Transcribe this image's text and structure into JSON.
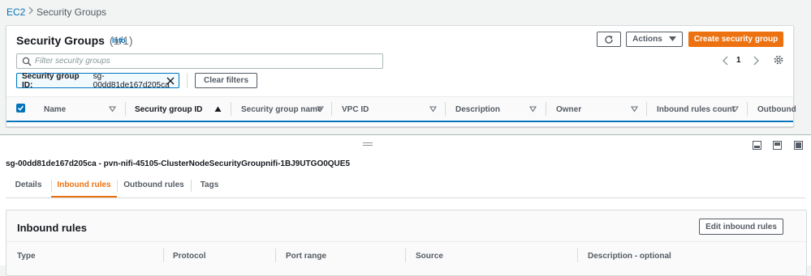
{
  "breadcrumb": {
    "root": "EC2",
    "current": "Security Groups"
  },
  "list_panel": {
    "title": "Security Groups",
    "count": "(1/1)",
    "info_label": "Info",
    "actions_label": "Actions",
    "create_label": "Create security group",
    "search_placeholder": "Filter security groups",
    "filter_key": "Security group ID:",
    "filter_value": "sg-00dd81de167d205ca",
    "clear_label": "Clear filters",
    "page_number": "1",
    "columns": [
      "Name",
      "Security group ID",
      "Security group name",
      "VPC ID",
      "Description",
      "Owner",
      "Inbound rules count",
      "Outbound"
    ]
  },
  "detail": {
    "title": "sg-00dd81de167d205ca - pvn-nifi-45105-ClusterNodeSecurityGroupnifi-1BJ9UTGO0QUE5",
    "tabs": [
      "Details",
      "Inbound rules",
      "Outbound rules",
      "Tags"
    ],
    "active_tab": "Inbound rules",
    "inbound_title": "Inbound rules",
    "edit_inbound_label": "Edit inbound rules",
    "inbound_columns": [
      "Type",
      "Protocol",
      "Port range",
      "Source",
      "Description - optional"
    ]
  },
  "colors": {
    "link": "#0073bb",
    "primary": "#ec7211",
    "background": "#f2f3f3",
    "text": "#16191f"
  },
  "icons": [
    "chevron-right-icon",
    "refresh-icon",
    "caret-down-icon",
    "search-icon",
    "chevron-left-icon",
    "settings-gear-icon",
    "close-icon",
    "check-icon",
    "sort-icon",
    "drag-handle-icon",
    "view-mode-icon"
  ]
}
